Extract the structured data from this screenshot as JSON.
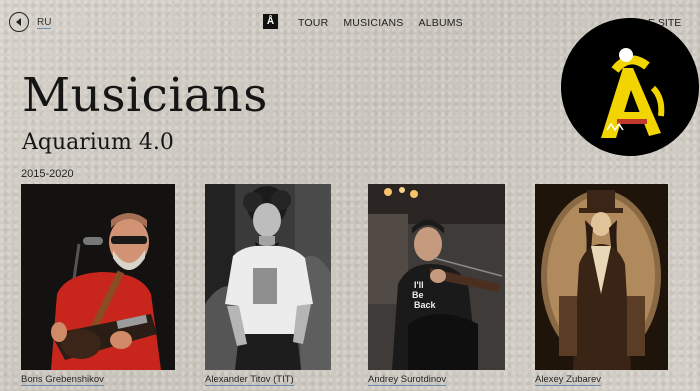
{
  "header": {
    "lang_label": "RU",
    "nav_logo": "Å",
    "nav": [
      "TOUR",
      "MUSICIANS",
      "ALBUMS"
    ],
    "site_link": "E SITE"
  },
  "page": {
    "title": "Musicians",
    "subtitle": "Aquarium 4.0",
    "years": "2015-2020"
  },
  "musicians": [
    {
      "name": "Boris Grebenshikov"
    },
    {
      "name": "Alexander Titov (TIT)"
    },
    {
      "name": "Andrey Surotdinov"
    },
    {
      "name": "Alexey Zubarev"
    }
  ],
  "colors": {
    "background": "#cfcbc3",
    "text": "#151515",
    "link_underline": "#6b8db0",
    "badge_yellow": "#f2d400"
  },
  "icons": {
    "back": "arrow-left-icon",
    "badge": "aquarium-logo-icon"
  },
  "photo_texts": {
    "shirt": "I'll Be Back"
  }
}
